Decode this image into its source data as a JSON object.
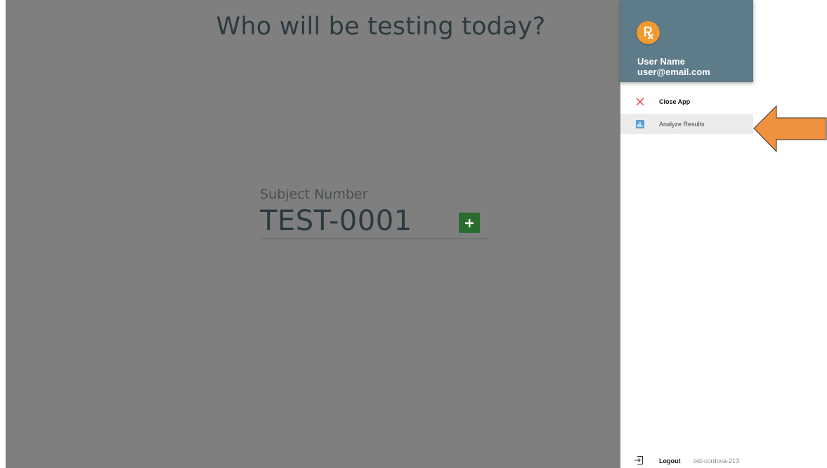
{
  "main": {
    "title": "Who will be testing today?",
    "subject": {
      "label": "Subject Number",
      "value": "TEST-0001"
    },
    "add_button_icon": "plus-icon"
  },
  "drawer": {
    "avatar_icon": "rx-icon",
    "user_name": "User Name",
    "user_email": "user@email.com",
    "menu": [
      {
        "label": "Close App",
        "icon": "close-icon"
      },
      {
        "label": "Analyze Results",
        "icon": "bar-chart-icon"
      }
    ],
    "footer": {
      "logout_label": "Logout",
      "version": "old-cordova-213"
    }
  },
  "colors": {
    "overlay": "#7f7f7f",
    "header": "#5e7b89",
    "avatar": "#f29a2e",
    "add_button": "#2a6b2e",
    "close_icon": "#e53935",
    "chart_icon": "#5aa0d8",
    "arrow": "#f0913f"
  }
}
